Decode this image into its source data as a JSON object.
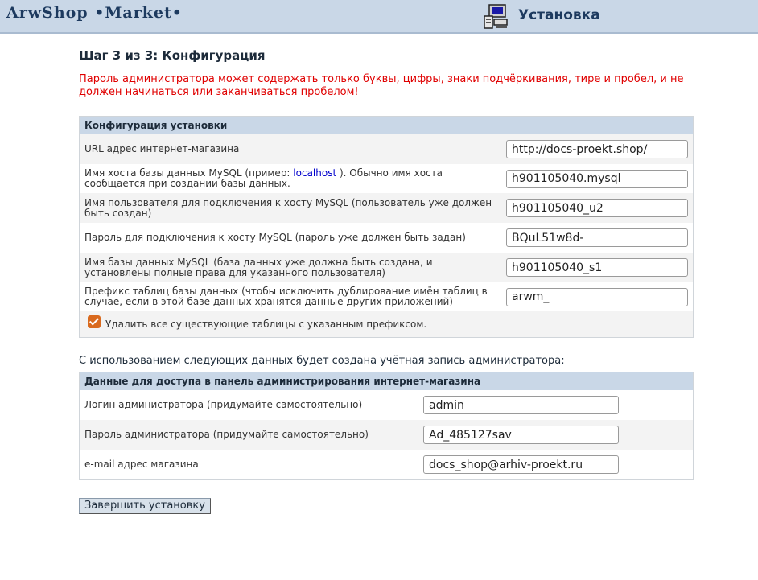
{
  "header": {
    "logo": "ArwShop •Market•",
    "icon": "computer-installer-icon",
    "title": "Установка"
  },
  "step_title": "Шаг 3 из 3: Конфигурация",
  "warning": "Пароль администратора может содержать только буквы, цифры, знаки подчёркивания, тире и пробел, и не должен начинаться или заканчиваться пробелом!",
  "config": {
    "heading": "Конфигурация установки",
    "url": {
      "label": "URL адрес интернет-магазина",
      "value": "http://docs-proekt.shop/"
    },
    "host": {
      "label_before": "Имя хоста базы данных MySQL (пример: ",
      "label_link": "localhost",
      "label_after": " ). Обычно имя хоста сообщается при создании базы данных.",
      "value": "h901105040.mysql"
    },
    "user": {
      "label": "Имя пользователя для подключения к хосту MySQL (пользователь уже должен быть создан)",
      "value": "h901105040_u2"
    },
    "password": {
      "label": "Пароль для подключения к хосту MySQL (пароль уже должен быть задан)",
      "value": "BQuL51w8d-"
    },
    "dbname": {
      "label": "Имя базы данных MySQL (база данных уже должна быть создана, и установлены полные права для указанного пользователя)",
      "value": "h901105040_s1"
    },
    "prefix": {
      "label": "Префикс таблиц базы данных (чтобы исключить дублирование имён таблиц в случае, если в этой базе данных хранятся данные других приложений)",
      "value": "arwm_"
    },
    "drop_tables": {
      "label": "Удалить все существующие таблицы с указанным префиксом.",
      "checked": true
    }
  },
  "admin_intro": "С использованием следующих данных будет создана учётная запись администратора:",
  "admin": {
    "heading": "Данные для доступа в панель администрирования интернет-магазина",
    "login": {
      "label": "Логин администратора (придумайте самостоятельно)",
      "value": "admin"
    },
    "password": {
      "label": "Пароль администратора (придумайте самостоятельно)",
      "value": "Ad_485127sav"
    },
    "email": {
      "label": "e-mail адрес магазина",
      "value": "docs_shop@arhiv-proekt.ru"
    }
  },
  "finish_button": "Завершить установку",
  "colors": {
    "header_bg": "#c9d7e7",
    "warning": "#e00000",
    "checkbox": "#d96a1e"
  }
}
